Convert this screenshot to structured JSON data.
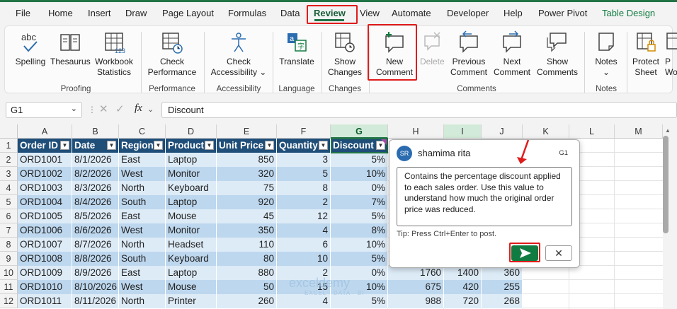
{
  "tabs": [
    "File",
    "Home",
    "Insert",
    "Draw",
    "Page Layout",
    "Formulas",
    "Data",
    "Review",
    "View",
    "Automate",
    "Developer",
    "Help",
    "Power Pivot",
    "Table Design"
  ],
  "ribbon": {
    "spelling": "Spelling",
    "thesaurus": "Thesaurus",
    "workbook_stats_1": "Workbook",
    "workbook_stats_2": "Statistics",
    "proofing": "Proofing",
    "check_perf_1": "Check",
    "check_perf_2": "Performance",
    "performance": "Performance",
    "check_access_1": "Check",
    "check_access_2": "Accessibility ⌄",
    "accessibility": "Accessibility",
    "translate": "Translate",
    "language": "Language",
    "show_changes_1": "Show",
    "show_changes_2": "Changes",
    "changes": "Changes",
    "new_comment_1": "New",
    "new_comment_2": "Comment",
    "delete": "Delete",
    "prev_comment_1": "Previous",
    "prev_comment_2": "Comment",
    "next_comment_1": "Next",
    "next_comment_2": "Comment",
    "show_comments_1": "Show",
    "show_comments_2": "Comments",
    "comments": "Comments",
    "notes_1": "Notes",
    "notes_2": "⌄",
    "notes": "Notes",
    "protect_sheet_1": "Protect",
    "protect_sheet_2": "Sheet",
    "protect_wb_1": "P",
    "protect_wb_2": "Wo"
  },
  "formula_bar": {
    "name_box": "G1",
    "fx": "fx",
    "formula": "Discount"
  },
  "columns": [
    "A",
    "B",
    "C",
    "D",
    "E",
    "F",
    "G",
    "H",
    "I",
    "J",
    "K",
    "L",
    "M"
  ],
  "table": {
    "headers": [
      "Order ID",
      "Date",
      "Region",
      "Product",
      "Unit Price",
      "Quantity",
      "Discount"
    ],
    "rows": [
      [
        "ORD1001",
        "8/1/2026",
        "East",
        "Laptop",
        "850",
        "3",
        "5%"
      ],
      [
        "ORD1002",
        "8/2/2026",
        "West",
        "Monitor",
        "320",
        "5",
        "10%"
      ],
      [
        "ORD1003",
        "8/3/2026",
        "North",
        "Keyboard",
        "75",
        "8",
        "0%"
      ],
      [
        "ORD1004",
        "8/4/2026",
        "South",
        "Laptop",
        "920",
        "2",
        "7%"
      ],
      [
        "ORD1005",
        "8/5/2026",
        "East",
        "Mouse",
        "45",
        "12",
        "5%"
      ],
      [
        "ORD1006",
        "8/6/2026",
        "West",
        "Monitor",
        "350",
        "4",
        "8%"
      ],
      [
        "ORD1007",
        "8/7/2026",
        "North",
        "Headset",
        "110",
        "6",
        "10%"
      ],
      [
        "ORD1008",
        "8/8/2026",
        "South",
        "Keyboard",
        "80",
        "10",
        "5%"
      ],
      [
        "ORD1009",
        "8/9/2026",
        "East",
        "Laptop",
        "880",
        "2",
        "0%"
      ],
      [
        "ORD1010",
        "8/10/2026",
        "West",
        "Mouse",
        "50",
        "15",
        "10%"
      ],
      [
        "ORD1011",
        "8/11/2026",
        "North",
        "Printer",
        "260",
        "4",
        "5%"
      ]
    ],
    "extra": [
      [
        "1760",
        "1400",
        "360"
      ],
      [
        "675",
        "420",
        "255"
      ],
      [
        "988",
        "720",
        "268"
      ]
    ]
  },
  "comment": {
    "avatar": "SR",
    "author": "shamima rita",
    "cell": "G1",
    "text": "Contains the percentage discount applied to each sales order. Use this value to understand how much the original order price was reduced.",
    "tip": "Tip: Press Ctrl+Enter to post.",
    "cancel": "✕"
  },
  "watermark": {
    "name": "exceldemy",
    "tag": "EXCEL · DATA · BI"
  },
  "colors": {
    "accent": "#217346",
    "header_fill": "#1f4e79",
    "band_fill": "#ddebf7",
    "highlight": "#e01b1b"
  }
}
